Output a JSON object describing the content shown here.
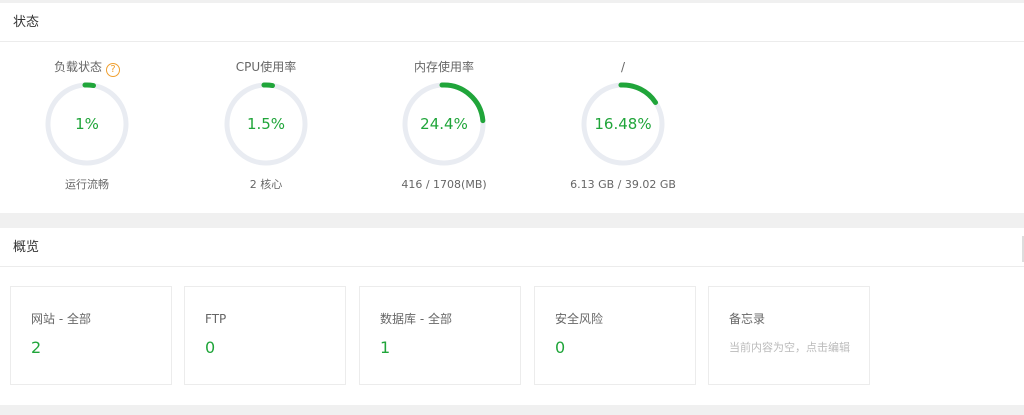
{
  "status": {
    "title": "状态",
    "gauges": [
      {
        "title": "负载状态",
        "help_icon": "?",
        "value": "1%",
        "percent": 1,
        "sub": "运行流畅"
      },
      {
        "title": "CPU使用率",
        "value": "1.5%",
        "percent": 1.5,
        "sub": "2 核心"
      },
      {
        "title": "内存使用率",
        "value": "24.4%",
        "percent": 24.4,
        "sub": "416 / 1708(MB)"
      },
      {
        "title": "/",
        "value": "16.48%",
        "percent": 16.48,
        "sub": "6.13 GB / 39.02 GB"
      }
    ],
    "colors": {
      "accent": "#20a53a",
      "track": "#e9ecf2",
      "help": "#f0a030"
    }
  },
  "overview": {
    "title": "概览",
    "cards": [
      {
        "title": "网站 - 全部",
        "value": "2"
      },
      {
        "title": "FTP",
        "value": "0"
      },
      {
        "title": "数据库 - 全部",
        "value": "1"
      },
      {
        "title": "安全风险",
        "value": "0"
      }
    ],
    "memo": {
      "title": "备忘录",
      "placeholder": "当前内容为空，点击编辑"
    }
  }
}
